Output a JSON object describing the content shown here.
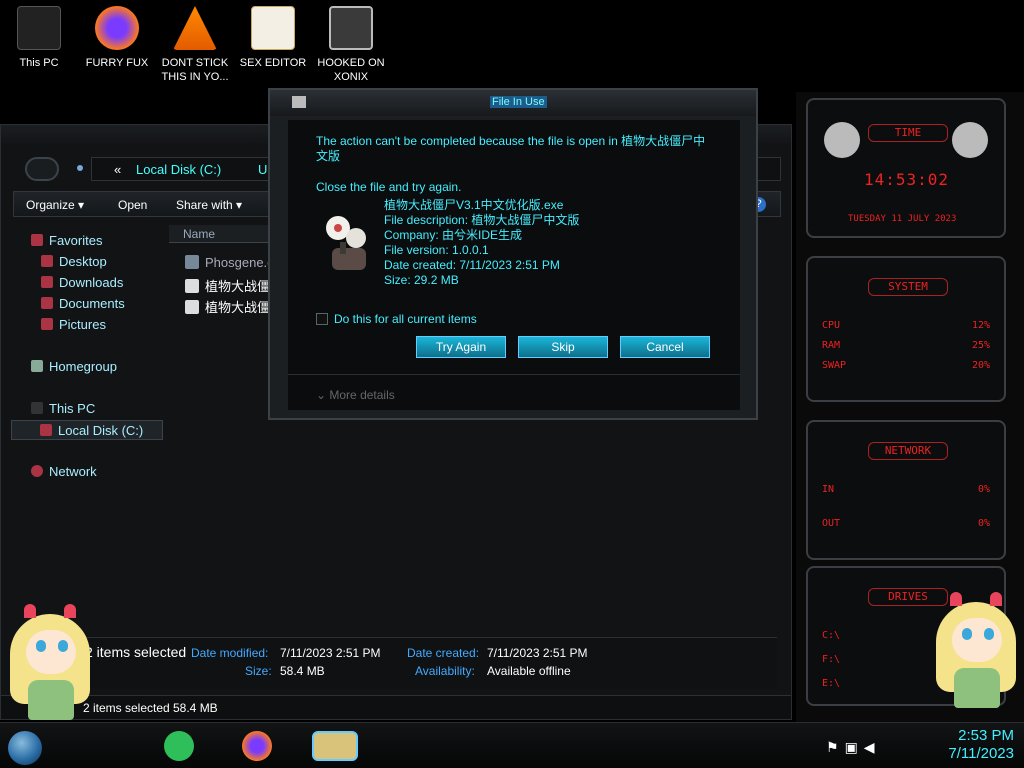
{
  "desktop_icons": [
    {
      "label": "This PC"
    },
    {
      "label": "FURRY FUX"
    },
    {
      "label": "DONT STICK THIS IN YO..."
    },
    {
      "label": "SEX EDITOR"
    },
    {
      "label": "HOOKED ON XONIX"
    }
  ],
  "explorer": {
    "address_items": [
      "«",
      "Local Disk (C:)",
      "Us"
    ],
    "toolbar": [
      "Organize ▾",
      "Open",
      "Share with ▾"
    ],
    "help": "?",
    "nav": {
      "favorites": "Favorites",
      "desktop": "Desktop",
      "downloads": "Downloads",
      "documents": "Documents",
      "pictures": "Pictures",
      "homegroup": "Homegroup",
      "this_pc": "This PC",
      "local_disk": "Local Disk (C:)",
      "network": "Network"
    },
    "column_name": "Name",
    "files": [
      "Phosgene.exe",
      "植物大战僵",
      "植物大战僵"
    ],
    "details": {
      "count": "2 items selected",
      "date_modified_label": "Date modified:",
      "date_modified": "7/11/2023 2:51 PM",
      "size_label": "Size:",
      "size": "58.4 MB",
      "date_created_label": "Date created:",
      "date_created": "7/11/2023 2:51 PM",
      "availability_label": "Availability:",
      "availability": "Available offline"
    },
    "status": {
      "selected": "2 items selected",
      "size": "58.4 MB"
    }
  },
  "dialog": {
    "title": "File In Use",
    "message": "The action can't be completed because the file is open in 植物大战僵尸中文版",
    "instruction": "Close the file and try again.",
    "file_name": "植物大战僵尸V3.1中文优化版.exe",
    "file_description": "File description: 植物大战僵尸中文版",
    "company": "Company: 由兮米IDE生成",
    "file_version": "File version: 1.0.0.1",
    "date_created": "Date created: 7/11/2023 2:51 PM",
    "size": "Size: 29.2 MB",
    "checkbox_label": "Do this for all current items",
    "buttons": {
      "try_again": "Try Again",
      "skip": "Skip",
      "cancel": "Cancel"
    },
    "more_details": "More details"
  },
  "gadgets": {
    "time_title": "TIME",
    "time": "14:53:02",
    "date": "TUESDAY 11 JULY 2023",
    "system_title": "SYSTEM",
    "cpu_label": "CPU",
    "cpu": "12%",
    "ram_label": "RAM",
    "ram": "25%",
    "swap_label": "SWAP",
    "swap": "20%",
    "network_title": "NETWORK",
    "in_label": "IN",
    "in": "0%",
    "out_label": "OUT",
    "out": "0%",
    "drives_title": "DRIVES",
    "drives": [
      "C:\\",
      "F:\\",
      "E:\\"
    ]
  },
  "taskbar": {
    "time": "2:53 PM",
    "date": "7/11/2023"
  },
  "colors": {
    "accent": "#1ab6d8",
    "text_cyan": "#44eeff",
    "gadget_red": "#e22222"
  }
}
